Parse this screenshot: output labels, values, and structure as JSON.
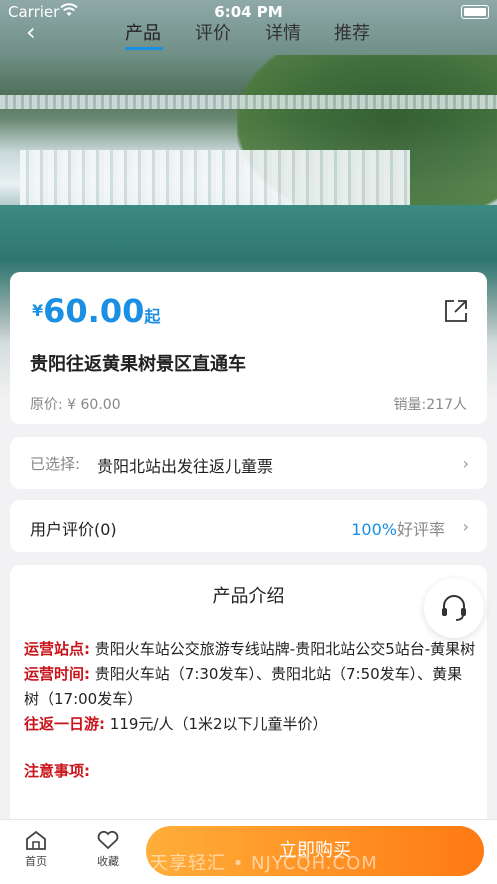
{
  "status": {
    "carrier": "Carrier",
    "time": "6:04 PM"
  },
  "nav": {
    "back": "‹",
    "tabs": [
      "产品",
      "评价",
      "详情",
      "推荐"
    ]
  },
  "price": {
    "yen": "¥",
    "value": "60.00",
    "suffix": "起"
  },
  "product": {
    "title": "贵阳往返黄果树景区直通车",
    "original_price": "原价: ¥ 60.00",
    "sales": "销量:217人"
  },
  "selection": {
    "label": "已选择:",
    "value": "贵阳北站出发往返儿童票"
  },
  "reviews": {
    "label": "用户评价(0)",
    "percent": "100%",
    "suffix": "好评率"
  },
  "intro": {
    "title": "产品介绍",
    "lines": [
      {
        "key": "运营站点:",
        "text": "贵阳火车站公交旅游专线站牌-贵阳北站公交5站台-黄果树"
      },
      {
        "key": "运营时间:",
        "text": "贵阳火车站（7:30发车）、贵阳北站（7:50发车）、黄果树（17:00发车）"
      },
      {
        "key": "往返一日游:",
        "text": "119元/人（1米2以下儿童半价）"
      }
    ],
    "notice": "注意事项:"
  },
  "bottom": {
    "home": "首页",
    "fav": "收藏",
    "buy": "立即购买"
  },
  "watermark": "天享轻汇 • NJYCQH.COM",
  "colors": {
    "accent": "#1a8fe3",
    "buy_start": "#ffae3a",
    "buy_end": "#ff7a12",
    "highlight": "#c9141a"
  }
}
